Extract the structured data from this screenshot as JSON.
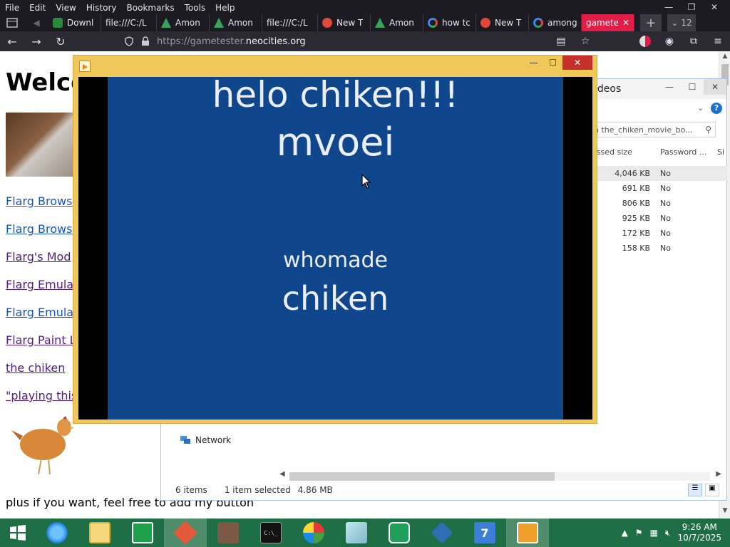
{
  "browser": {
    "menu": [
      "File",
      "Edit",
      "View",
      "History",
      "Bookmarks",
      "Tools",
      "Help"
    ],
    "tabs": [
      {
        "label": "Downl",
        "icon": "firefox-icon"
      },
      {
        "label": "file:///C:/L",
        "icon": "file-icon"
      },
      {
        "label": "Amon",
        "icon": "amongus-icon"
      },
      {
        "label": "Amon",
        "icon": "amongus-icon"
      },
      {
        "label": "file:///C:/L",
        "icon": "file-icon"
      },
      {
        "label": "New T",
        "icon": "firefox-icon"
      },
      {
        "label": "Amon",
        "icon": "amongus-icon"
      },
      {
        "label": "how tc",
        "icon": "google-icon"
      },
      {
        "label": "New T",
        "icon": "firefox-icon"
      },
      {
        "label": "among",
        "icon": "google-icon"
      },
      {
        "label": "gamete",
        "icon": "none",
        "active": true
      }
    ],
    "tab_count": "12",
    "url_prefix": "https://gametester.",
    "url_domain": "neocities.org"
  },
  "page": {
    "title": "Welco",
    "links": [
      {
        "label": "Flarg Browse",
        "visited": false
      },
      {
        "label": "Flarg Browse",
        "visited": false
      },
      {
        "label": "Flarg's Mod",
        "visited": true
      },
      {
        "label": "Flarg Emulat",
        "visited": true
      },
      {
        "label": "Flarg Emulat",
        "visited": false
      },
      {
        "label": "Flarg Paint L",
        "visited": true
      },
      {
        "label": "the chiken",
        "visited": true
      },
      {
        "label": "\"playing this",
        "visited": true
      }
    ],
    "bottom_text": "plus if you want, feel free to add my button"
  },
  "explorer": {
    "title": "ideos",
    "search_placeholder": "h the_chiken_movie_bo...",
    "columns": [
      "essed size",
      "Password ...",
      "Si"
    ],
    "rows": [
      {
        "size": "4,046 KB",
        "password": "No",
        "selected": true
      },
      {
        "size": "691 KB",
        "password": "No"
      },
      {
        "size": "806 KB",
        "password": "No"
      },
      {
        "size": "925 KB",
        "password": "No"
      },
      {
        "size": "172 KB",
        "password": "No"
      },
      {
        "size": "158 KB",
        "password": "No"
      }
    ],
    "network_label": "Network",
    "status_items": "6 items",
    "status_selected": "1 item selected",
    "status_size": "4.86 MB"
  },
  "player": {
    "line1": "helo chiken!!!",
    "line2": "mvoei",
    "line3": "whomade",
    "line4": "chiken"
  },
  "taskbar": {
    "time": "9:26 AM",
    "date": "10/7/2025"
  },
  "colors": {
    "taskbar": "#1e6e45",
    "video_bg": "#0f468c",
    "player_frame": "#f0c85a",
    "active_tab": "#e11d48"
  }
}
